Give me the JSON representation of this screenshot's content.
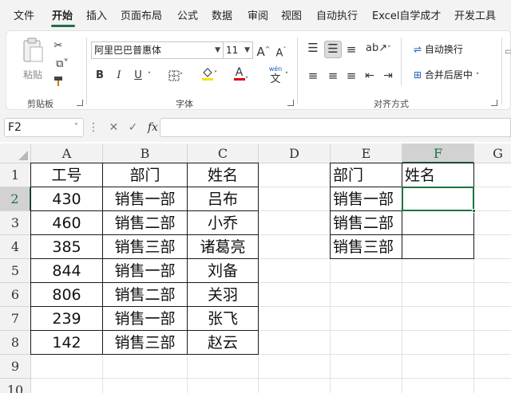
{
  "menu": {
    "tabs": [
      "文件",
      "开始",
      "插入",
      "页面布局",
      "公式",
      "数据",
      "审阅",
      "视图",
      "自动执行",
      "Excel自学成才",
      "开发工具"
    ],
    "active_tab": "开始"
  },
  "ribbon": {
    "clipboard": {
      "paste_label": "粘贴",
      "group_label": "剪贴板"
    },
    "font": {
      "font_name": "阿里巴巴普惠体",
      "font_size": "11",
      "bold": "B",
      "italic": "I",
      "underline": "U",
      "grow": "A",
      "shrink": "A",
      "phonetic_top": "wén",
      "phonetic_bottom": "文",
      "group_label": "字体"
    },
    "alignment": {
      "wrap_text": "自动换行",
      "merge_center": "合并后居中",
      "group_label": "对齐方式"
    }
  },
  "formula_bar": {
    "name_box": "F2",
    "formula": "",
    "fx_label": "fx"
  },
  "sheet": {
    "columns": [
      "A",
      "B",
      "C",
      "D",
      "E",
      "F",
      "G"
    ],
    "rows": [
      "1",
      "2",
      "3",
      "4",
      "5",
      "6",
      "7",
      "8",
      "9",
      "10"
    ],
    "selected_cell": "F2",
    "table1": {
      "headers": [
        "工号",
        "部门",
        "姓名"
      ],
      "rows": [
        [
          "430",
          "销售一部",
          "吕布"
        ],
        [
          "460",
          "销售二部",
          "小乔"
        ],
        [
          "385",
          "销售三部",
          "诸葛亮"
        ],
        [
          "844",
          "销售一部",
          "刘备"
        ],
        [
          "806",
          "销售二部",
          "关羽"
        ],
        [
          "239",
          "销售一部",
          "张飞"
        ],
        [
          "142",
          "销售三部",
          "赵云"
        ]
      ]
    },
    "table2": {
      "headers": [
        "部门",
        "姓名"
      ],
      "rows": [
        [
          "销售一部",
          ""
        ],
        [
          "销售二部",
          ""
        ],
        [
          "销售三部",
          ""
        ]
      ]
    }
  },
  "colors": {
    "accent": "#1e7145",
    "font_color_bar": "#e00000",
    "highlight_bar": "#ffe000"
  }
}
